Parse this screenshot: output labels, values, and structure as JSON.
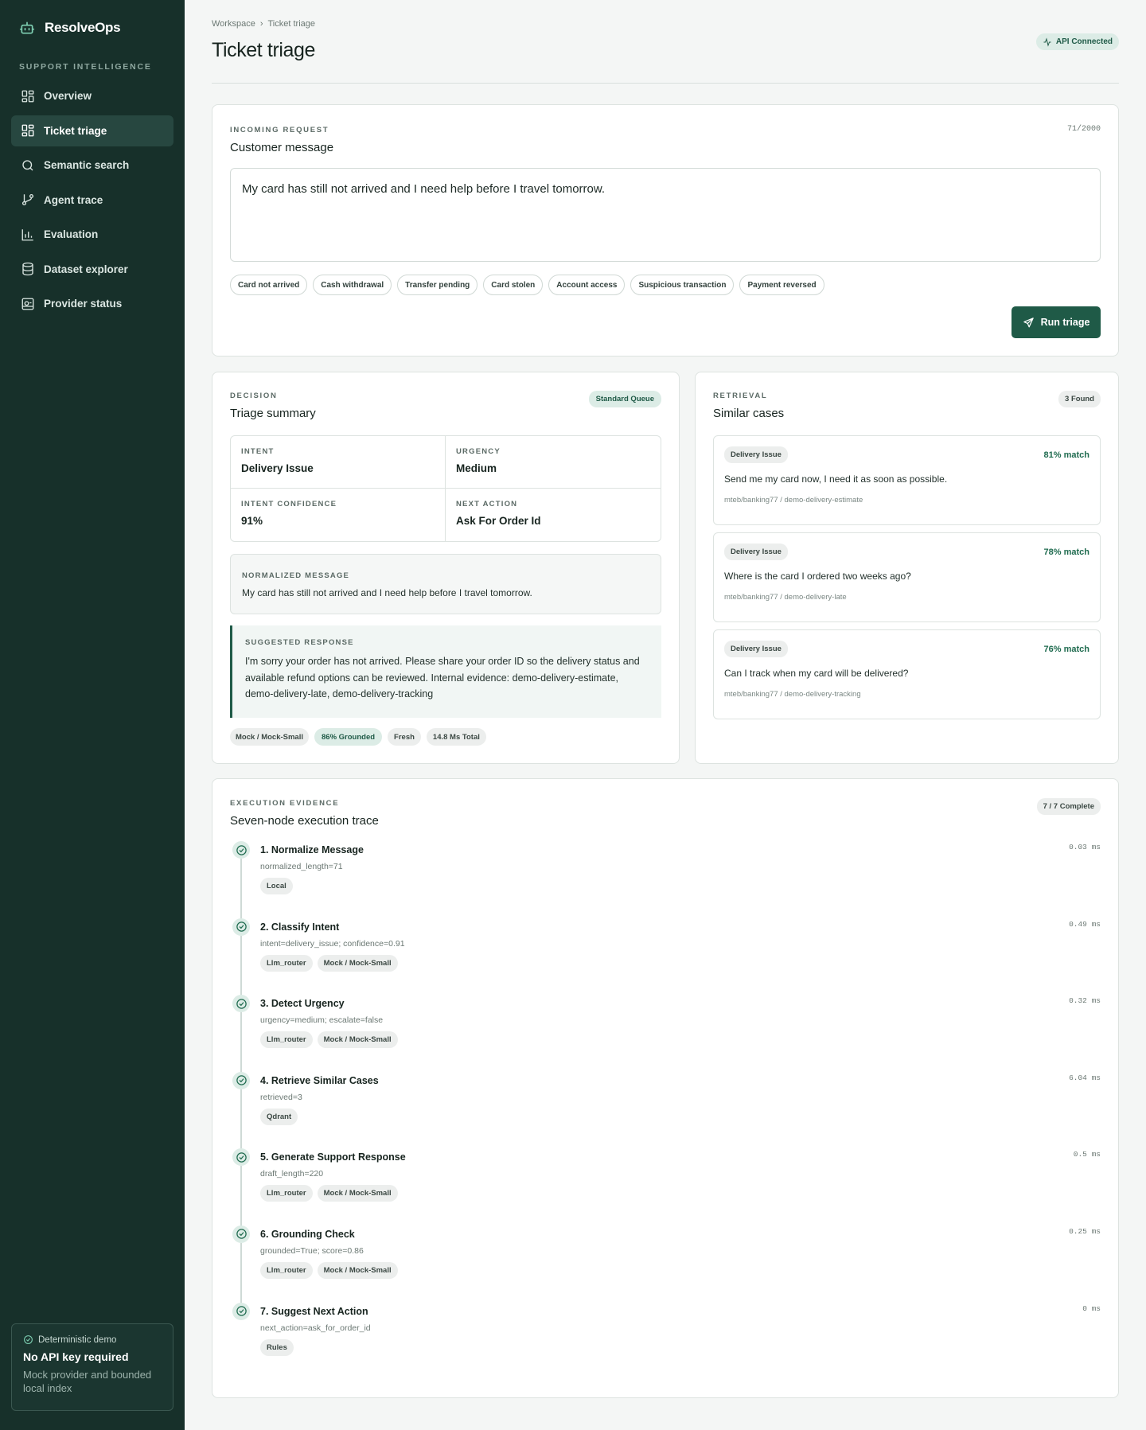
{
  "sidebar": {
    "brand": "ResolveOps",
    "section_heading": "SUPPORT INTELLIGENCE",
    "items": [
      {
        "label": "Overview",
        "icon": "layout-grid-icon"
      },
      {
        "label": "Ticket triage",
        "icon": "layout-grid-icon"
      },
      {
        "label": "Semantic search",
        "icon": "search-icon"
      },
      {
        "label": "Agent trace",
        "icon": "git-branch-icon"
      },
      {
        "label": "Evaluation",
        "icon": "bar-chart-icon"
      },
      {
        "label": "Dataset explorer",
        "icon": "database-icon"
      },
      {
        "label": "Provider status",
        "icon": "server-icon"
      }
    ],
    "demo": {
      "label": "Deterministic demo",
      "title": "No API key required",
      "description": "Mock provider and bounded local index"
    }
  },
  "header": {
    "breadcrumb": [
      "Workspace",
      "Ticket triage"
    ],
    "title": "Ticket triage",
    "api_status": "API Connected"
  },
  "request": {
    "eyebrow": "INCOMING REQUEST",
    "title": "Customer message",
    "char_count": "71/2000",
    "message": "My card has still not arrived and I need help before I travel tomorrow.",
    "chips": [
      "Card not arrived",
      "Cash withdrawal",
      "Transfer pending",
      "Card stolen",
      "Account access",
      "Suspicious transaction",
      "Payment reversed"
    ],
    "run_label": "Run triage"
  },
  "decision": {
    "eyebrow": "DECISION",
    "title": "Triage summary",
    "queue_badge": "Standard Queue",
    "intent_label": "INTENT",
    "intent": "Delivery Issue",
    "urgency_label": "URGENCY",
    "urgency": "Medium",
    "confidence_label": "INTENT CONFIDENCE",
    "confidence": "91%",
    "next_action_label": "NEXT ACTION",
    "next_action": "Ask For Order Id",
    "normalized_label": "NORMALIZED MESSAGE",
    "normalized": "My card has still not arrived and I need help before I travel tomorrow.",
    "suggested_label": "SUGGESTED RESPONSE",
    "suggested": "I'm sorry your order has not arrived. Please share your order ID so the delivery status and available refund options can be reviewed. Internal evidence: demo-delivery-estimate, demo-delivery-late, demo-delivery-tracking",
    "meta": {
      "provider": "Mock / Mock-Small",
      "grounded": "86% Grounded",
      "freshness": "Fresh",
      "total": "14.8 Ms Total"
    }
  },
  "retrieval": {
    "eyebrow": "RETRIEVAL",
    "title": "Similar cases",
    "found_badge": "3 Found",
    "cases": [
      {
        "tag": "Delivery Issue",
        "match": "81% match",
        "question": "Send me my card now, I need it as soon as possible.",
        "source": "mteb/banking77 / demo-delivery-estimate"
      },
      {
        "tag": "Delivery Issue",
        "match": "78% match",
        "question": "Where is the card I ordered two weeks ago?",
        "source": "mteb/banking77 / demo-delivery-late"
      },
      {
        "tag": "Delivery Issue",
        "match": "76% match",
        "question": "Can I track when my card will be delivered?",
        "source": "mteb/banking77 / demo-delivery-tracking"
      }
    ]
  },
  "execution": {
    "eyebrow": "EXECUTION EVIDENCE",
    "title": "Seven-node execution trace",
    "complete_badge": "7 / 7 Complete",
    "steps": [
      {
        "name": "1. Normalize Message",
        "detail": "normalized_length=71",
        "tags": [
          "Local"
        ],
        "ms": "0.03 ms"
      },
      {
        "name": "2. Classify Intent",
        "detail": "intent=delivery_issue; confidence=0.91",
        "tags": [
          "Llm_router",
          "Mock / Mock-Small"
        ],
        "ms": "0.49 ms"
      },
      {
        "name": "3. Detect Urgency",
        "detail": "urgency=medium; escalate=false",
        "tags": [
          "Llm_router",
          "Mock / Mock-Small"
        ],
        "ms": "0.32 ms"
      },
      {
        "name": "4. Retrieve Similar Cases",
        "detail": "retrieved=3",
        "tags": [
          "Qdrant"
        ],
        "ms": "6.04 ms"
      },
      {
        "name": "5. Generate Support Response",
        "detail": "draft_length=220",
        "tags": [
          "Llm_router",
          "Mock / Mock-Small"
        ],
        "ms": "0.5 ms"
      },
      {
        "name": "6. Grounding Check",
        "detail": "grounded=True; score=0.86",
        "tags": [
          "Llm_router",
          "Mock / Mock-Small"
        ],
        "ms": "0.25 ms"
      },
      {
        "name": "7. Suggest Next Action",
        "detail": "next_action=ask_for_order_id",
        "tags": [
          "Rules"
        ],
        "ms": "0 ms"
      }
    ]
  }
}
